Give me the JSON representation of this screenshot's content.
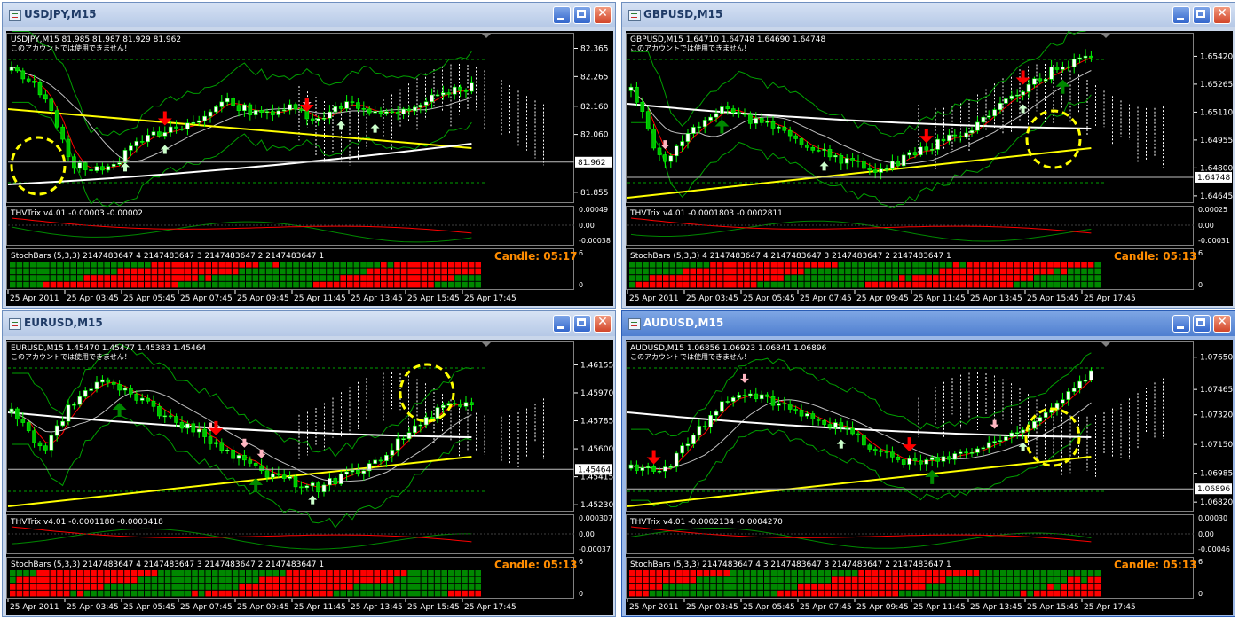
{
  "windows": [
    {
      "title": "USDJPY,M15",
      "active": false,
      "info": "USDJPY,M15  81.985 81.987 81.929 81.962",
      "notice": "このアカウントでは使用できません！",
      "price_ticks": [
        "82.365",
        "82.265",
        "82.160",
        "82.060",
        "81.962",
        "81.855"
      ],
      "current_price": "81.962",
      "price_range": [
        81.82,
        82.42
      ],
      "trix_label": "THVTrix v4.01 -0.00003 -0.00002",
      "trix_ticks": [
        "0.00049",
        "0.00",
        "-0.00038"
      ],
      "stoch_label": "StochBars (5,3,3) 2147483647 4 2147483647 3 2147483647 2 2147483647 1",
      "stoch_ticks": [
        "6",
        "0"
      ],
      "candle_label": "Candle:  05:17",
      "time_labels": [
        "25 Apr 2011",
        "25 Apr 03:45",
        "25 Apr 05:45",
        "25 Apr 07:45",
        "25 Apr 09:45",
        "25 Apr 11:45",
        "25 Apr 13:45",
        "25 Apr 15:45",
        "25 Apr 17:45"
      ]
    },
    {
      "title": "GBPUSD,M15",
      "active": false,
      "info": "GBPUSD,M15  1.64710 1.64748 1.64690 1.64748",
      "notice": "このアカウントでは使用できません！",
      "price_ticks": [
        "1.65420",
        "1.65265",
        "1.65110",
        "1.64955",
        "1.64800",
        "1.64748",
        "1.64645"
      ],
      "current_price": "1.64748",
      "price_range": [
        1.6461,
        1.6555
      ],
      "trix_label": "THVTrix v4.01 -0.0001803 -0.0002811",
      "trix_ticks": [
        "0.00025",
        "0.00",
        "-0.00031"
      ],
      "stoch_label": "StochBars (5,3,3) 4 2147483647 4 2147483647 3 2147483647 2 2147483647 1",
      "stoch_ticks": [
        "6",
        "0"
      ],
      "candle_label": "Candle:  05:13",
      "time_labels": [
        "25 Apr 2011",
        "25 Apr 03:45",
        "25 Apr 05:45",
        "25 Apr 07:45",
        "25 Apr 09:45",
        "25 Apr 11:45",
        "25 Apr 13:45",
        "25 Apr 15:45",
        "25 Apr 17:45"
      ]
    },
    {
      "title": "EURUSD,M15",
      "active": false,
      "info": "EURUSD,M15  1.45470 1.45477 1.45383 1.45464",
      "notice": "このアカウントでは使用できません！",
      "price_ticks": [
        "1.46155",
        "1.45970",
        "1.45785",
        "1.45600",
        "1.45464",
        "1.45415",
        "1.45230"
      ],
      "current_price": "1.45464",
      "price_range": [
        1.4519,
        1.4631
      ],
      "trix_label": "THVTrix v4.01 -0.0001180 -0.0003418",
      "trix_ticks": [
        "0.000307",
        "0.00",
        "-0.00037"
      ],
      "stoch_label": "StochBars (5,3,3) 2147483647 4 2147483647 3 2147483647 2 2147483647 1",
      "stoch_ticks": [
        "6",
        "0"
      ],
      "candle_label": "Candle:  05:13",
      "time_labels": [
        "25 Apr 2011",
        "25 Apr 03:45",
        "25 Apr 05:45",
        "25 Apr 07:45",
        "25 Apr 09:45",
        "25 Apr 11:45",
        "25 Apr 13:45",
        "25 Apr 15:45",
        "25 Apr 17:45"
      ]
    },
    {
      "title": "AUDUSD,M15",
      "active": true,
      "info": "AUDUSD,M15  1.06856 1.06923 1.06841 1.06896",
      "notice": "このアカウントでは使用できません！",
      "price_ticks": [
        "1.07650",
        "1.07465",
        "1.07320",
        "1.07150",
        "1.06985",
        "1.06896",
        "1.06820"
      ],
      "current_price": "1.06896",
      "price_range": [
        1.0677,
        1.0774
      ],
      "trix_label": "THVTrix v4.01 -0.0002134 -0.0004270",
      "trix_ticks": [
        "0.00030",
        "0.00",
        "-0.00046"
      ],
      "stoch_label": "StochBars (5,3,3) 2147483647 4 3 2147483647 3 2147483647 2 2147483647 1",
      "stoch_ticks": [
        "6",
        "0"
      ],
      "candle_label": "Candle:  05:13",
      "time_labels": [
        "25 Apr 2011",
        "25 Apr 03:45",
        "25 Apr 05:45",
        "25 Apr 07:45",
        "25 Apr 09:45",
        "25 Apr 11:45",
        "25 Apr 13:45",
        "25 Apr 15:45",
        "25 Apr 17:45"
      ]
    }
  ],
  "colors": {
    "background": "#000000",
    "bull_candle": "#ffffff",
    "bear_candle": "#00c000",
    "candle_wick": "#00ff00",
    "ma_fast": "#ff0000",
    "ma_slow": "#ffffff",
    "ma_long": "#ffff00",
    "envelope": "#00a000",
    "cloud": "#ffffff",
    "trix_up": "#008800",
    "trix_down": "#ff0000",
    "stoch_up": "#008800",
    "stoch_down": "#ff0000",
    "candle_text": "#ff8c00",
    "axis_text": "#ffffff",
    "highlight_circle": "#ffff00",
    "arrow_buy_strong": "#008800",
    "arrow_buy_weak": "#ccffcc",
    "arrow_sell_strong": "#ff0000",
    "arrow_sell_weak": "#ffb6c1"
  },
  "window_buttons": {
    "minimize": "minimize",
    "maximize": "maximize",
    "close": "✕"
  }
}
